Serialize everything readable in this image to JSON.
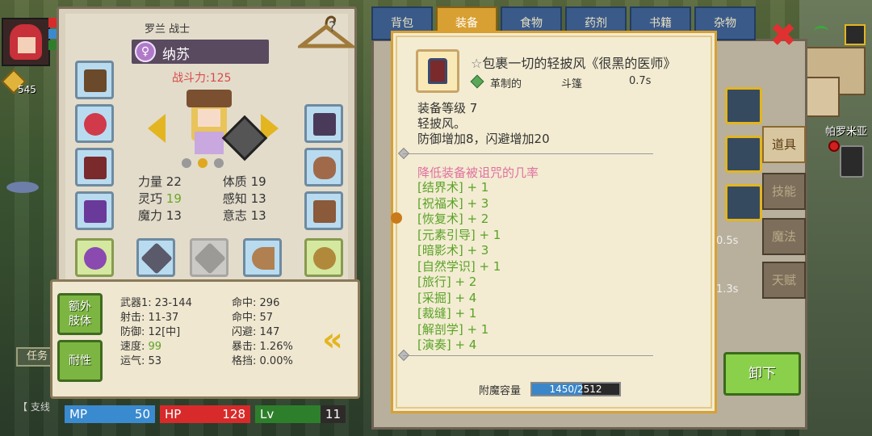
{
  "hud": {
    "gold": "545",
    "task_label": "任务",
    "support_label": "【 支线"
  },
  "world": {
    "place_name": "帕罗米亚"
  },
  "character": {
    "class_label": "罗兰 战士",
    "name": "纳苏",
    "emblem": "♀",
    "power": "战斗力:125",
    "attributes": [
      {
        "label": "力量",
        "value": "22"
      },
      {
        "label": "体质",
        "value": "19"
      },
      {
        "label": "灵巧",
        "value": "19"
      },
      {
        "label": "感知",
        "value": "13"
      },
      {
        "label": "魔力",
        "value": "13"
      },
      {
        "label": "意志",
        "value": "13"
      }
    ]
  },
  "stat_box": {
    "buttons": [
      "额外\n肢体",
      "耐性"
    ],
    "col1": [
      {
        "label": "武器1:",
        "value": "23-144"
      },
      {
        "label": "射击:",
        "value": "11-37"
      },
      {
        "label": "防御:",
        "value": "12[中]"
      },
      {
        "label": "速度:",
        "value": "99"
      },
      {
        "label": "运气:",
        "value": "53"
      }
    ],
    "col2": [
      {
        "label": "命中:",
        "value": "296"
      },
      {
        "label": "命中:",
        "value": "57"
      },
      {
        "label": "闪避:",
        "value": "147"
      },
      {
        "label": "暴击:",
        "value": "1.26%"
      },
      {
        "label": "格挡:",
        "value": "0.00%"
      }
    ]
  },
  "bars": {
    "mp_label": "MP",
    "mp_value": "50",
    "hp_label": "HP",
    "hp_value": "128",
    "lv_label": "Lv",
    "lv_value": "11"
  },
  "tabs": [
    "背包",
    "装备",
    "食物",
    "药剂",
    "书籍",
    "杂物"
  ],
  "active_tab": "装备",
  "item": {
    "star": "☆",
    "title": "包裹一切的轻披风《很黑的医师》",
    "material": "革制的",
    "type": "斗篷",
    "weight": "0.7s",
    "desc_lines": [
      "装备等级 7",
      "轻披风。",
      "防御增加8，闪避增加20"
    ],
    "curse": "降低装备被诅咒的几率",
    "skills": [
      "[结界术] + 1",
      "[祝福术] + 3",
      "[恢复术] + 2",
      "[元素引导] + 1",
      "[暗影术] + 3",
      "[自然学识] + 1",
      "[旅行] + 2",
      "[采掘] + 4",
      "[裁缝] + 1",
      "[解剖学] + 1",
      "[演奏] + 4"
    ],
    "enchant_label": "附魔容量",
    "enchant_value": "1450/2512",
    "enchant_ratio": 0.577
  },
  "right_tabs": [
    "道具",
    "技能",
    "魔法",
    "天赋"
  ],
  "active_right_tab": "道具",
  "unequip_label": "卸下",
  "bg_times": [
    "0.5s",
    "1.3s"
  ],
  "colors": {
    "accent_gold": "#e3b521",
    "skill_green": "#5aa228",
    "curse_pink": "#e070a0",
    "mp_blue": "#3a8ad0",
    "hp_red": "#d82a2a",
    "lv_green": "#2e7f2c"
  }
}
